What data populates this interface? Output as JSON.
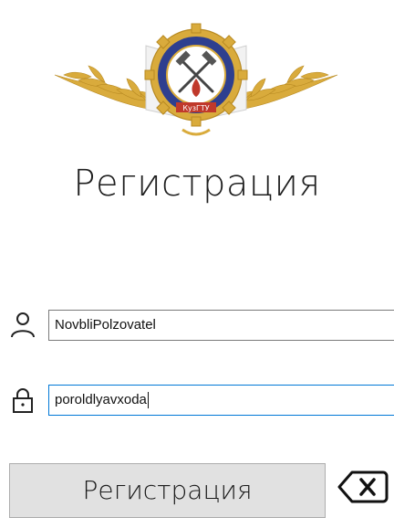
{
  "header": {
    "logo": {
      "icon": "university-emblem-icon",
      "inscription": "КузГТУ"
    },
    "title": "Регистрация"
  },
  "form": {
    "login": {
      "icon": "user-icon",
      "value": "NovbliPolzovatel"
    },
    "password": {
      "icon": "lock-icon",
      "value": "poroldlyavxoda"
    },
    "register_button": "Регистрация",
    "back_icon": "backspace-icon"
  },
  "colors": {
    "background": "#ffffff",
    "button_bg": "#e1e1e1",
    "focus_border": "#0078d7",
    "emblem_gold": "#d8a83a",
    "emblem_ring": "#2e3f8f",
    "emblem_red": "#c0392b"
  }
}
